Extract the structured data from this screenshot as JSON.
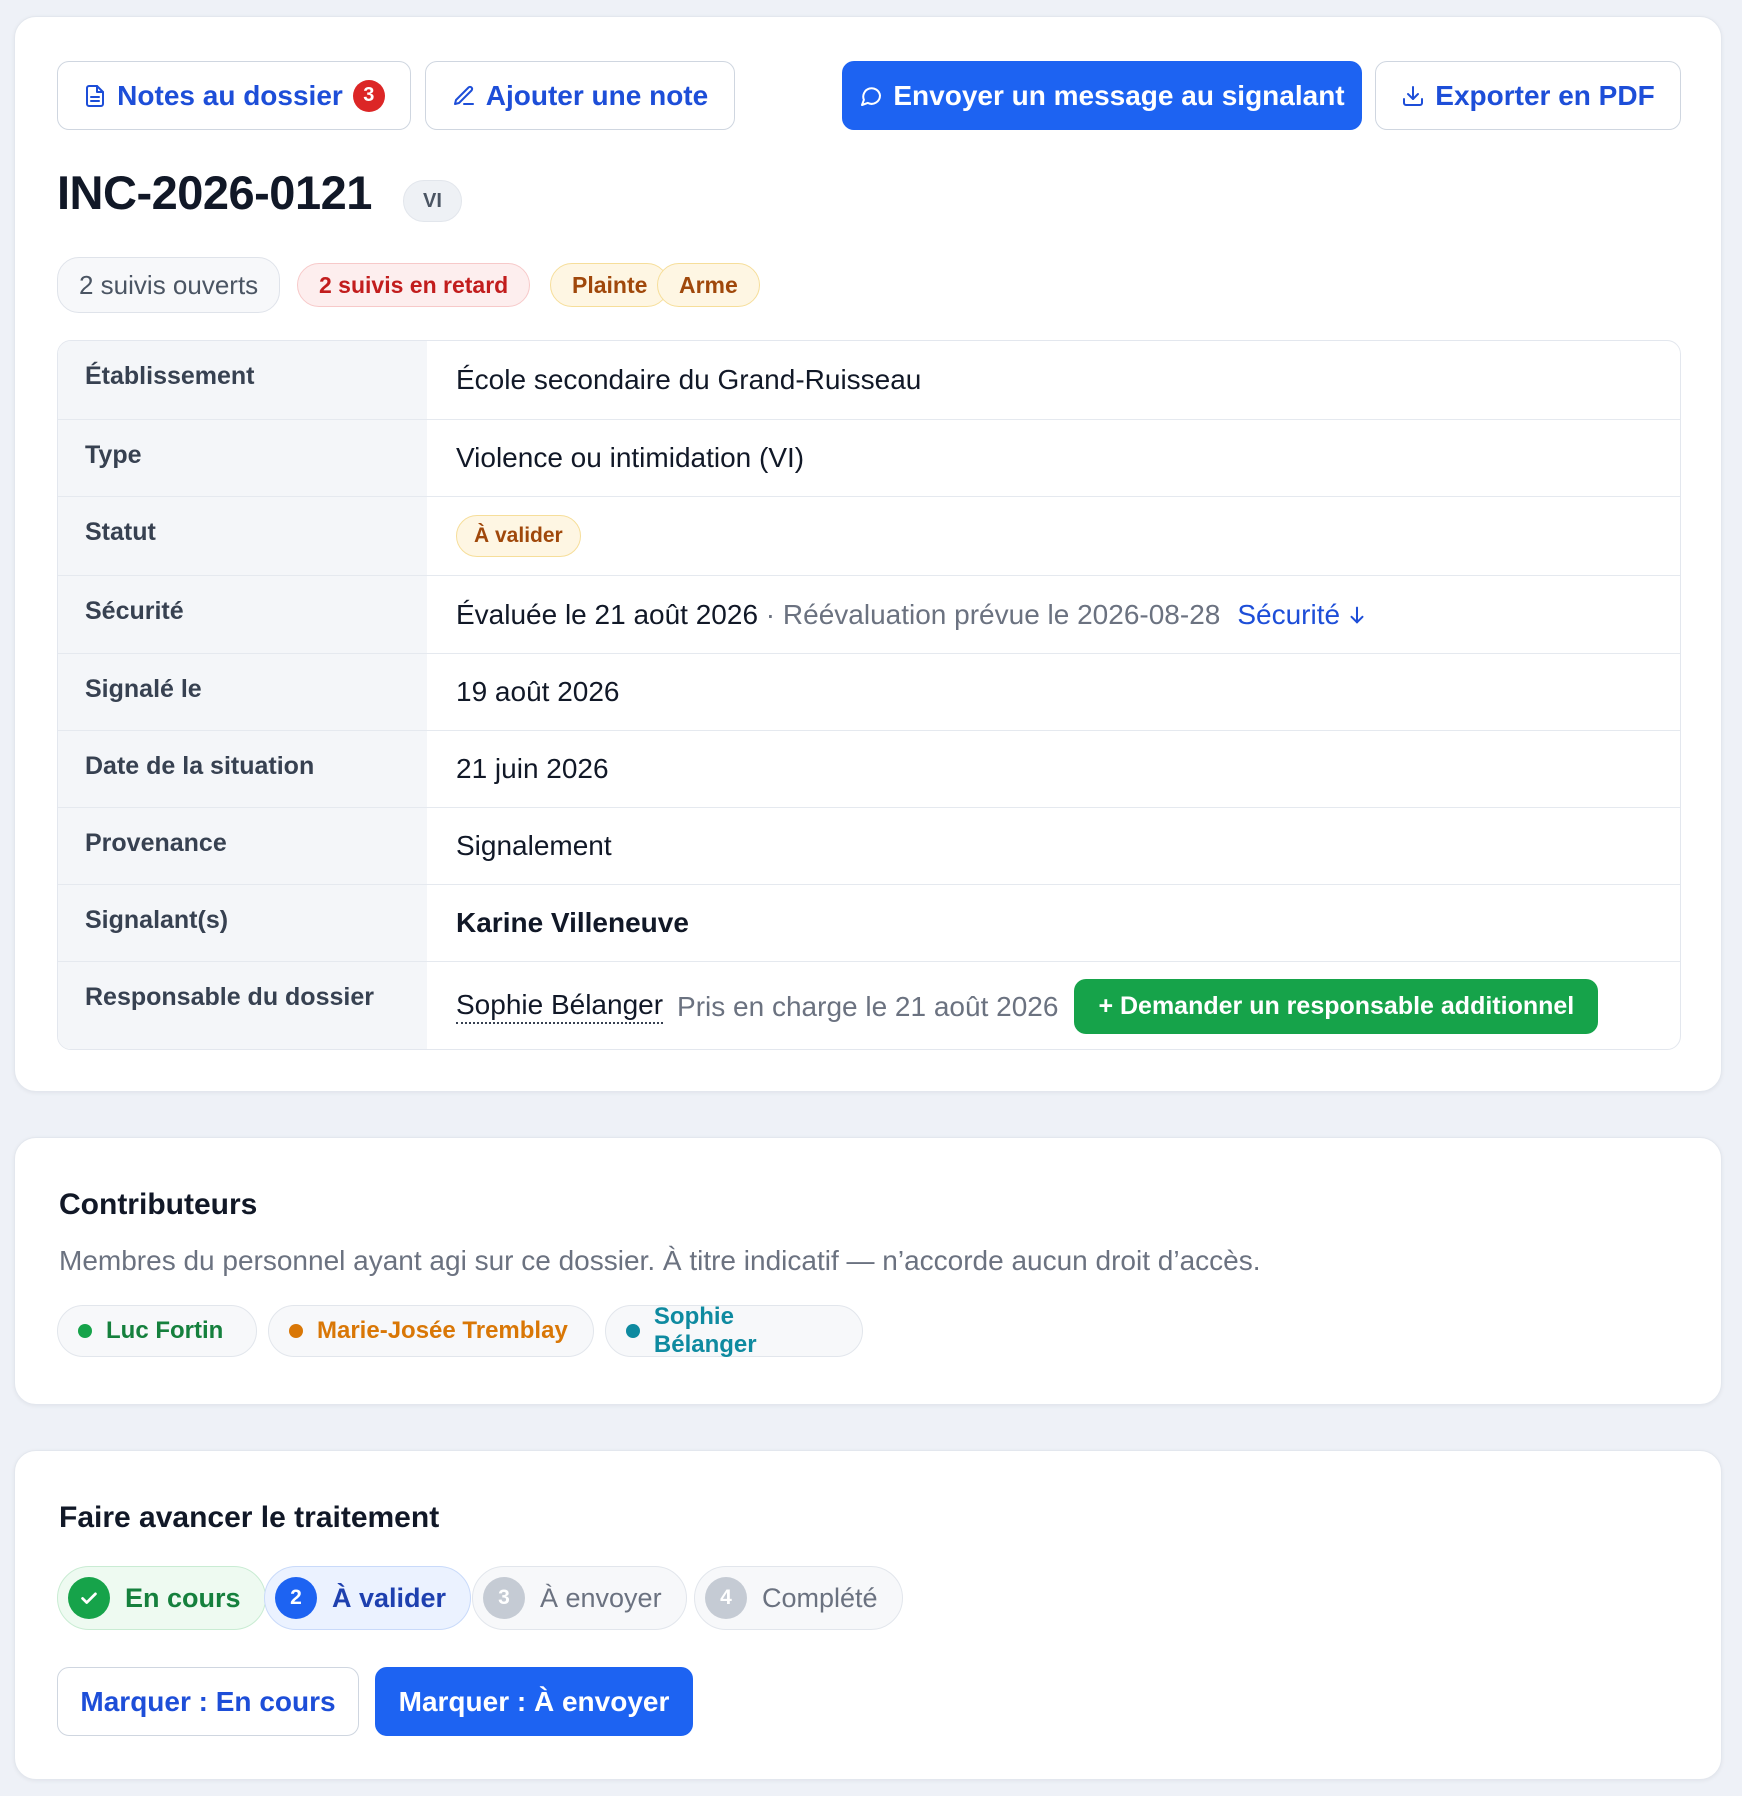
{
  "toolbar": {
    "notes_label": "Notes au dossier",
    "notes_count": "3",
    "add_note_label": "Ajouter une note",
    "message_label": "Envoyer un message au signalant",
    "export_label": "Exporter en PDF"
  },
  "incident": {
    "id": "INC-2026-0121",
    "type_code": "VI",
    "tags": [
      {
        "label": "2 suivis ouverts",
        "style": "neutral"
      },
      {
        "label": "2 suivis en retard",
        "style": "red"
      },
      {
        "label": "Plainte",
        "style": "amber"
      },
      {
        "label": "Arme",
        "style": "amber"
      }
    ]
  },
  "details": {
    "establishment": {
      "label": "Établissement",
      "value": "École secondaire du Grand-Ruisseau"
    },
    "type": {
      "label": "Type",
      "value": "Violence ou intimidation (VI)"
    },
    "status": {
      "label": "Statut",
      "value": "À valider"
    },
    "security": {
      "label": "Sécurité",
      "evaluated": "Évaluée le 21 août 2026",
      "separator": " · ",
      "reevaluation": "Réévaluation prévue le 2026-08-28",
      "link": "Sécurité"
    },
    "reported_on": {
      "label": "Signalé le",
      "value": "19 août 2026"
    },
    "situation_date": {
      "label": "Date de la situation",
      "value": "21 juin 2026"
    },
    "origin": {
      "label": "Provenance",
      "value": "Signalement"
    },
    "reporters": {
      "label": "Signalant(s)",
      "value": "Karine Villeneuve"
    },
    "owner": {
      "label": "Responsable du dossier",
      "name": "Sophie Bélanger",
      "taken": "Pris en charge le 21 août 2026",
      "button": "+ Demander un responsable additionnel"
    }
  },
  "contributors": {
    "title": "Contributeurs",
    "description": "Membres du personnel ayant agi sur ce dossier. À titre indicatif — n’accorde aucun droit d’accès.",
    "people": [
      {
        "name": "Luc Fortin",
        "color": "#15803d",
        "dot": "#16a34a"
      },
      {
        "name": "Marie-Josée Tremblay",
        "color": "#d97706",
        "dot": "#d97706"
      },
      {
        "name": "Sophie Bélanger",
        "color": "#0e8aa0",
        "dot": "#0e8aa0"
      }
    ]
  },
  "progress": {
    "title": "Faire avancer le traitement",
    "steps": [
      {
        "number": "1",
        "label": "En cours",
        "state": "done"
      },
      {
        "number": "2",
        "label": "À valider",
        "state": "current"
      },
      {
        "number": "3",
        "label": "À envoyer",
        "state": "todo"
      },
      {
        "number": "4",
        "label": "Complété",
        "state": "todo"
      }
    ],
    "mark_back_label": "Marquer : En cours",
    "mark_next_label": "Marquer : À envoyer"
  },
  "colors": {
    "accent": "#1d63f2",
    "success": "#16a34a",
    "danger": "#dc2626",
    "warning_text": "#a0480b"
  },
  "icons": {
    "notes": "document-icon",
    "add_note": "pencil-icon",
    "message": "chat-bubble-icon",
    "export": "download-icon",
    "security_link": "arrow-down-icon",
    "step_done": "checkmark-icon"
  }
}
